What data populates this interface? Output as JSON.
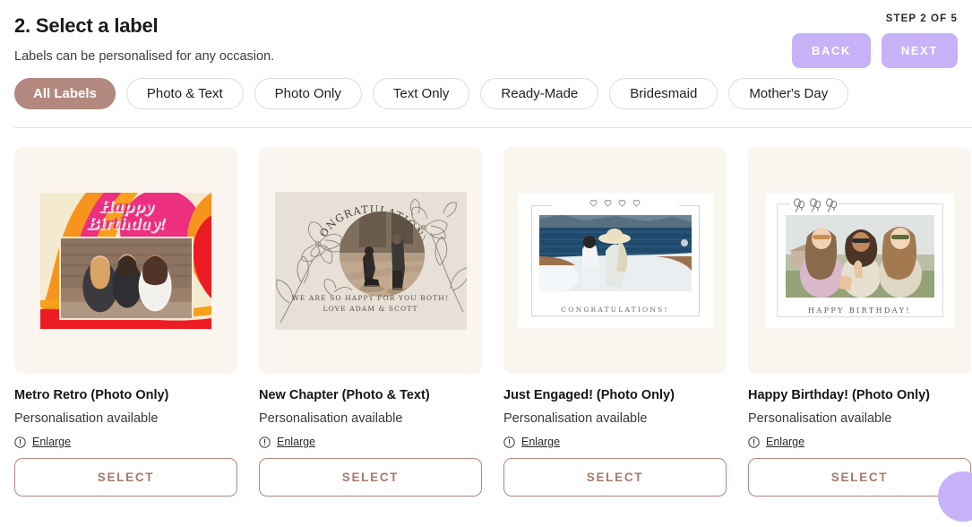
{
  "header": {
    "title": "2. Select a label",
    "subtitle": "Labels can be personalised for any occasion.",
    "step_text": "STEP 2 OF 5",
    "back_label": "BACK",
    "next_label": "NEXT",
    "button_color": "#c7b2f7"
  },
  "filters": {
    "active_index": 0,
    "accent_color": "#b3887e",
    "items": [
      {
        "label": "All Labels",
        "active": true
      },
      {
        "label": "Photo & Text",
        "active": false
      },
      {
        "label": "Photo Only",
        "active": false
      },
      {
        "label": "Text Only",
        "active": false
      },
      {
        "label": "Ready-Made",
        "active": false
      },
      {
        "label": "Bridesmaid",
        "active": false
      },
      {
        "label": "Mother's Day",
        "active": false
      }
    ]
  },
  "products": [
    {
      "title": "Metro Retro (Photo Only)",
      "subtitle": "Personalisation available",
      "enlarge_label": "Enlarge",
      "select_label": "SELECT",
      "artwork": {
        "headline_line1": "Happy",
        "headline_line2": "Birthday!",
        "style": "retro-swirl",
        "colors": [
          "#f2e8cf",
          "#f7941e",
          "#ed1c24",
          "#ec2f7f",
          "#f9a01b"
        ]
      }
    },
    {
      "title": "New Chapter (Photo & Text)",
      "subtitle": "Personalisation available",
      "enlarge_label": "Enlarge",
      "select_label": "SELECT",
      "artwork": {
        "arch_text": "CONGRATULATIONS",
        "message_line1": "WE ARE SO HAPPY FOR YOU BOTH!",
        "message_line2": "LOVE ADAM & SCOTT",
        "style": "floral-arch",
        "colors": [
          "#e6e0d6",
          "#585043"
        ]
      }
    },
    {
      "title": "Just Engaged! (Photo Only)",
      "subtitle": "Personalisation available",
      "enlarge_label": "Enlarge",
      "select_label": "SELECT",
      "artwork": {
        "caption": "CONGRATULATIONS!",
        "hearts_count": 4,
        "style": "white-frame-hearts",
        "colors": [
          "#ffffff",
          "#6e6a66"
        ]
      }
    },
    {
      "title": "Happy Birthday! (Photo Only)",
      "subtitle": "Personalisation available",
      "enlarge_label": "Enlarge",
      "select_label": "SELECT",
      "artwork": {
        "caption": "HAPPY BIRTHDAY!",
        "balloons_count": 3,
        "style": "white-frame-balloons",
        "colors": [
          "#ffffff",
          "#5d5a57"
        ]
      }
    }
  ],
  "help": {
    "icon": "help-bubble-icon",
    "color": "#c7b2f7"
  }
}
